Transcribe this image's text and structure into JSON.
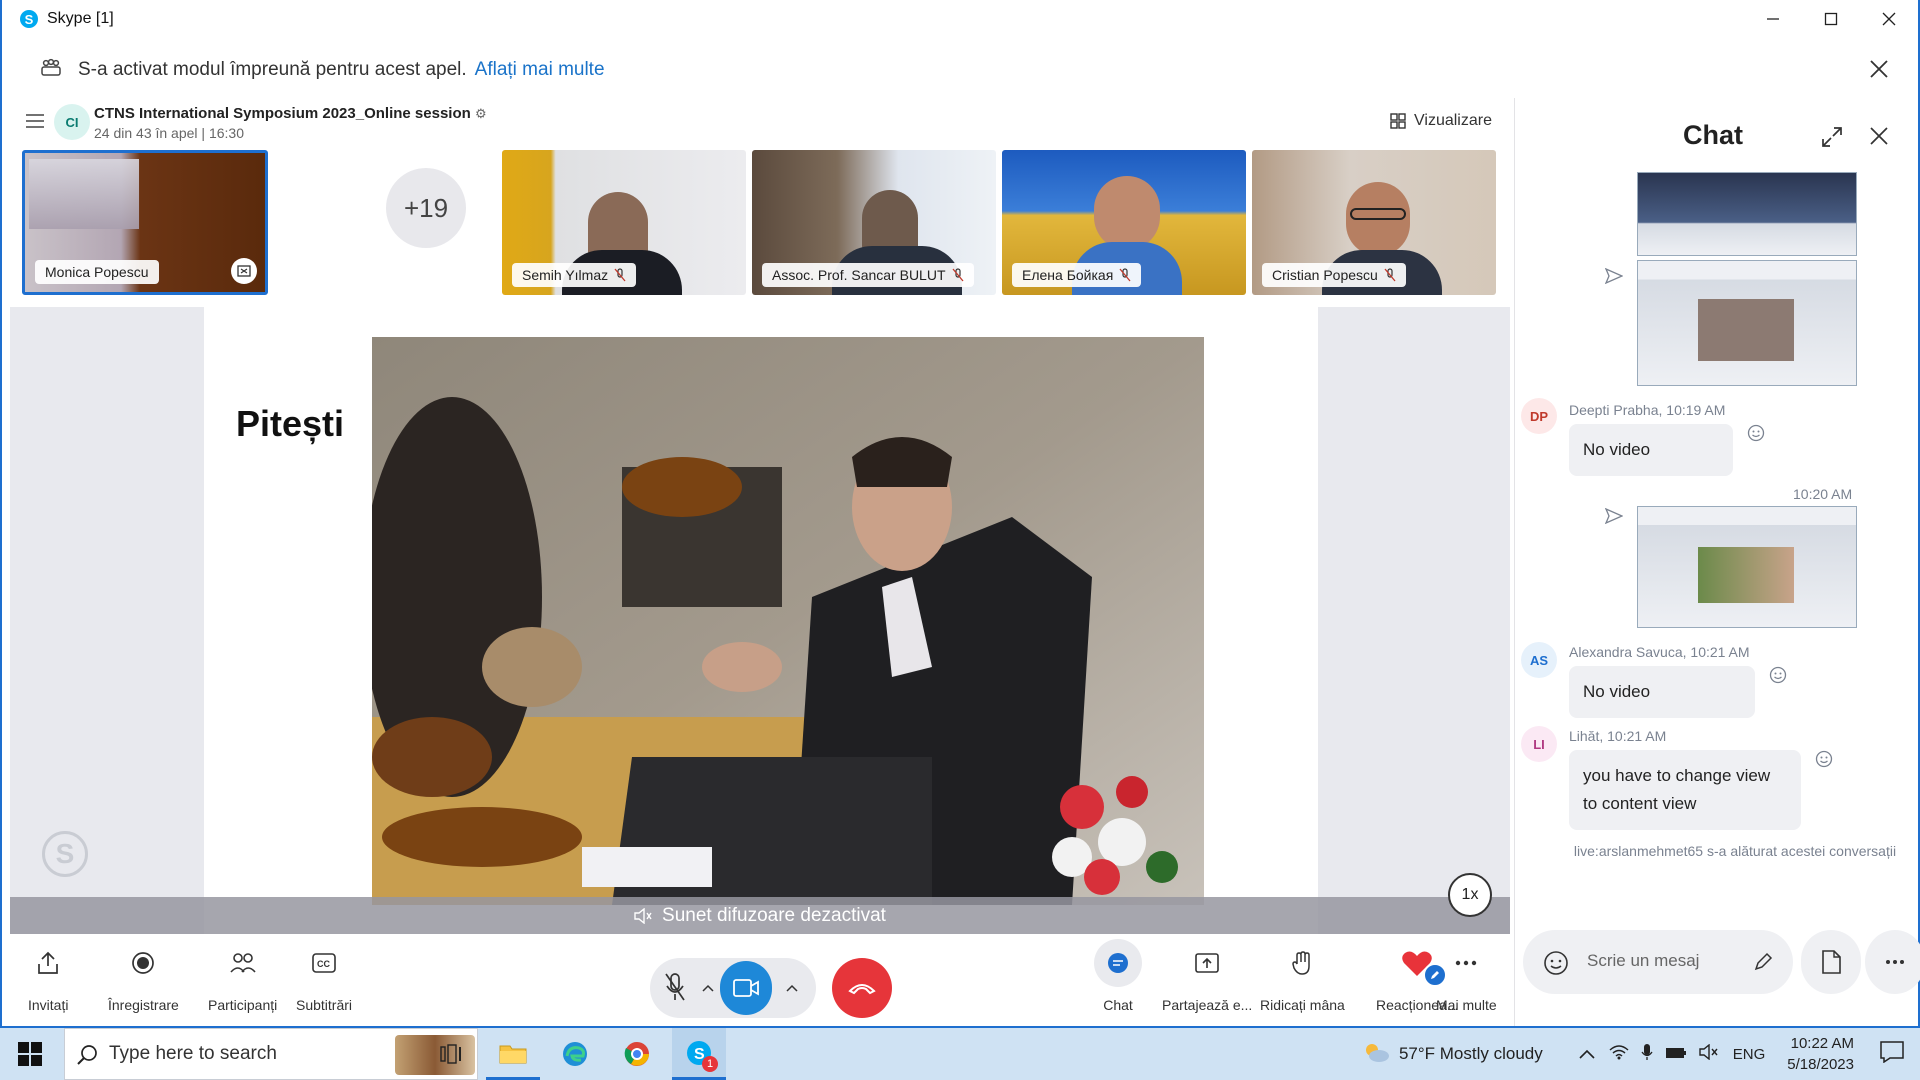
{
  "window": {
    "title": "Skype [1]"
  },
  "banner": {
    "text": "S-a activat modul împreună pentru acest apel.",
    "link": "Aflați mai multe"
  },
  "call": {
    "title": "CTNS International Symposium 2023_Online session",
    "subtitle": "24 din 43 în apel | 16:30",
    "view_label": "Vizualizare",
    "more_participants": "+19",
    "participants": [
      {
        "name": "Monica Popescu"
      },
      {
        "name": "Semih Yılmaz"
      },
      {
        "name": "Assoc. Prof. Sancar BULUT"
      },
      {
        "name": "Елена Бойкая"
      },
      {
        "name": "Cristian Popescu"
      }
    ],
    "slide_title": "Pitești",
    "speaker_notice": "Sunet difuzoare dezactivat",
    "playback_speed": "1x"
  },
  "toolbar": {
    "invite": "Invitați",
    "record": "Înregistrare",
    "participants": "Participanți",
    "subtitles": "Subtitrări",
    "chat": "Chat",
    "share": "Partajează e...",
    "raise_hand": "Ridicați mâna",
    "react": "Reacționea...",
    "more": "Mai multe"
  },
  "chat": {
    "title": "Chat",
    "messages": [
      {
        "initials": "DP",
        "author_time": "Deepti Prabha, 10:19 AM",
        "text": "No video"
      },
      {
        "time": "10:20 AM"
      },
      {
        "initials": "AS",
        "author_time": "Alexandra Savuca, 10:21 AM",
        "text": "No video"
      },
      {
        "initials": "LI",
        "author_time": "Lihăt, 10:21 AM",
        "text": "you have to change view to content view"
      }
    ],
    "system": "live:arslanmehmet65 s-a alăturat acestei conversații",
    "composer_placeholder": "Scrie un mesaj"
  },
  "taskbar": {
    "search_placeholder": "Type here to search",
    "weather": "57°F  Mostly cloudy",
    "lang": "ENG",
    "time": "10:22 AM",
    "date": "5/18/2023",
    "skype_badge": "1"
  },
  "colors": {
    "accent": "#1a73c9",
    "end_call": "#e6353a",
    "video_on": "#1e88d8",
    "heart": "#e8333a",
    "taskbar": "#cfe2f3"
  }
}
